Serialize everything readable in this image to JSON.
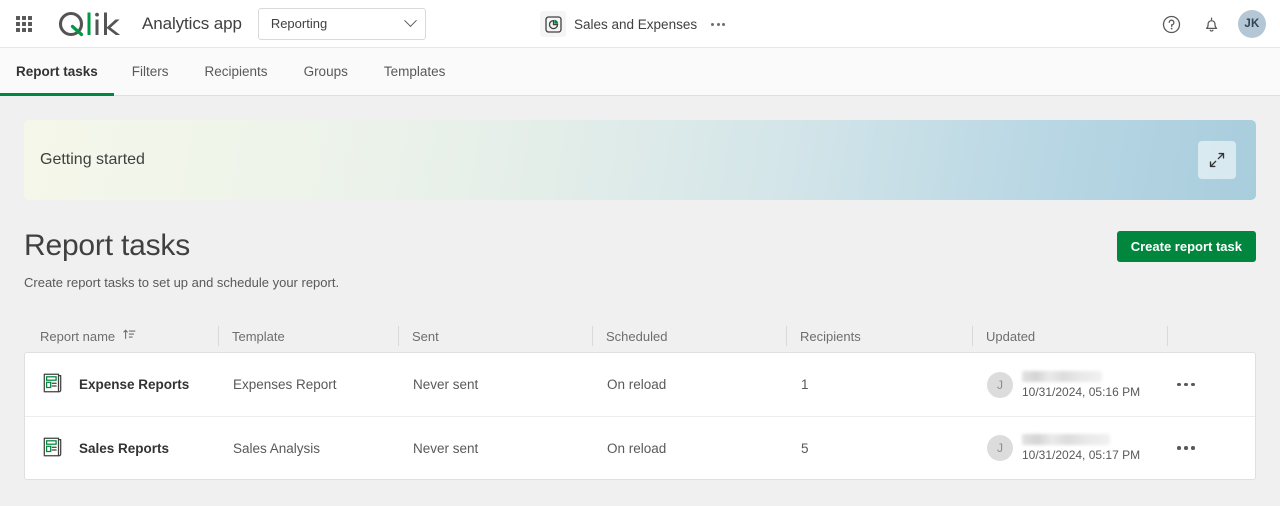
{
  "header": {
    "launcher_label": "app-launcher",
    "logo_text": "Qlik",
    "app_title": "Analytics app",
    "space_selector": {
      "value": "Reporting"
    },
    "app_chip": {
      "name": "Sales and Expenses"
    },
    "help_label": "Help",
    "notifications_label": "Notifications",
    "avatar_initials": "JK"
  },
  "tabs": [
    {
      "label": "Report tasks",
      "active": true
    },
    {
      "label": "Filters",
      "active": false
    },
    {
      "label": "Recipients",
      "active": false
    },
    {
      "label": "Groups",
      "active": false
    },
    {
      "label": "Templates",
      "active": false
    }
  ],
  "banner": {
    "title": "Getting started",
    "expand_label": "expand"
  },
  "page": {
    "title": "Report tasks",
    "subtitle": "Create report tasks to set up and schedule your report.",
    "create_button": "Create report task"
  },
  "table": {
    "columns": [
      {
        "label": "Report name",
        "sort": "ascending"
      },
      {
        "label": "Template"
      },
      {
        "label": "Sent"
      },
      {
        "label": "Scheduled"
      },
      {
        "label": "Recipients"
      },
      {
        "label": "Updated"
      },
      {
        "label": ""
      }
    ],
    "rows": [
      {
        "icon": "report-icon",
        "name": "Expense Reports",
        "template": "Expenses Report",
        "sent": "Never sent",
        "scheduled": "On reload",
        "recipients": "1",
        "updated_avatar": "J",
        "updated_user": "",
        "updated_date": "10/31/2024, 05:16 PM"
      },
      {
        "icon": "report-icon",
        "name": "Sales Reports",
        "template": "Sales Analysis",
        "sent": "Never sent",
        "scheduled": "On reload",
        "recipients": "5",
        "updated_avatar": "J",
        "updated_user": "",
        "updated_date": "10/31/2024, 05:17 PM"
      }
    ]
  },
  "colors": {
    "brand_green": "#00873d",
    "page_bg": "#f0f0f0",
    "text_primary": "#404040",
    "text_muted": "#6e6e6e"
  }
}
